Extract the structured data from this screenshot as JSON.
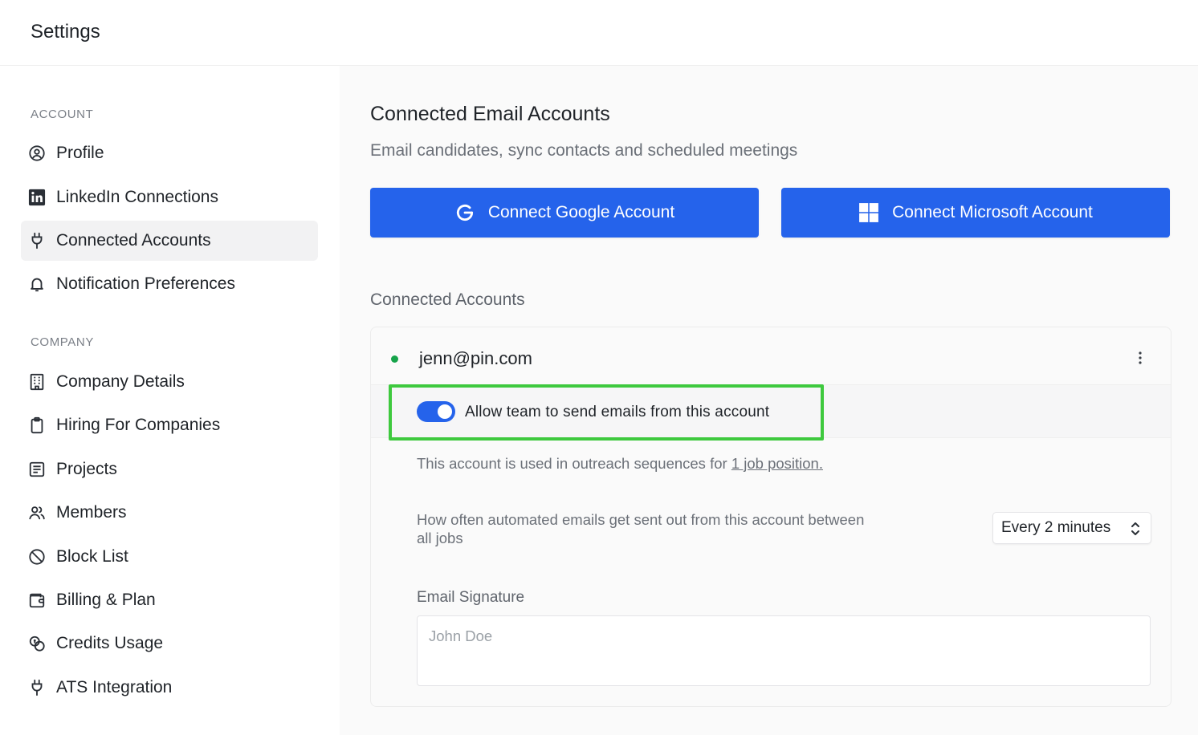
{
  "header": {
    "title": "Settings"
  },
  "sidebar": {
    "sections": [
      {
        "label": "ACCOUNT",
        "items": [
          {
            "label": "Profile",
            "icon": "user-circle-icon"
          },
          {
            "label": "LinkedIn Connections",
            "icon": "linkedin-icon"
          },
          {
            "label": "Connected Accounts",
            "icon": "plug-icon",
            "active": true
          },
          {
            "label": "Notification Preferences",
            "icon": "bell-icon"
          }
        ]
      },
      {
        "label": "COMPANY",
        "items": [
          {
            "label": "Company Details",
            "icon": "building-icon"
          },
          {
            "label": "Hiring For Companies",
            "icon": "clipboard-icon"
          },
          {
            "label": "Projects",
            "icon": "document-list-icon"
          },
          {
            "label": "Members",
            "icon": "users-icon"
          },
          {
            "label": "Block List",
            "icon": "ban-icon"
          },
          {
            "label": "Billing & Plan",
            "icon": "wallet-icon"
          },
          {
            "label": "Credits Usage",
            "icon": "coins-icon"
          },
          {
            "label": "ATS Integration",
            "icon": "plug-icon"
          }
        ]
      }
    ]
  },
  "main": {
    "title": "Connected Email Accounts",
    "subtitle": "Email candidates, sync contacts and scheduled meetings",
    "connect_google_label": "Connect Google Account",
    "connect_microsoft_label": "Connect Microsoft Account",
    "connected_heading": "Connected Accounts",
    "account": {
      "email": "jenn@pin.com",
      "status_color": "#16a34a",
      "toggle_label": "Allow team to send emails from this account",
      "toggle_on": true,
      "usage_prefix": "This account is used in outreach sequences for ",
      "usage_link": "1 job position.",
      "frequency_label": "How often automated emails get sent out from this account between all jobs",
      "frequency_value": "Every 2 minutes",
      "signature_label": "Email Signature",
      "signature_placeholder": "John Doe",
      "signature_value": ""
    }
  },
  "colors": {
    "accent": "#2563eb",
    "highlight": "#3ec93e",
    "status": "#16a34a"
  }
}
